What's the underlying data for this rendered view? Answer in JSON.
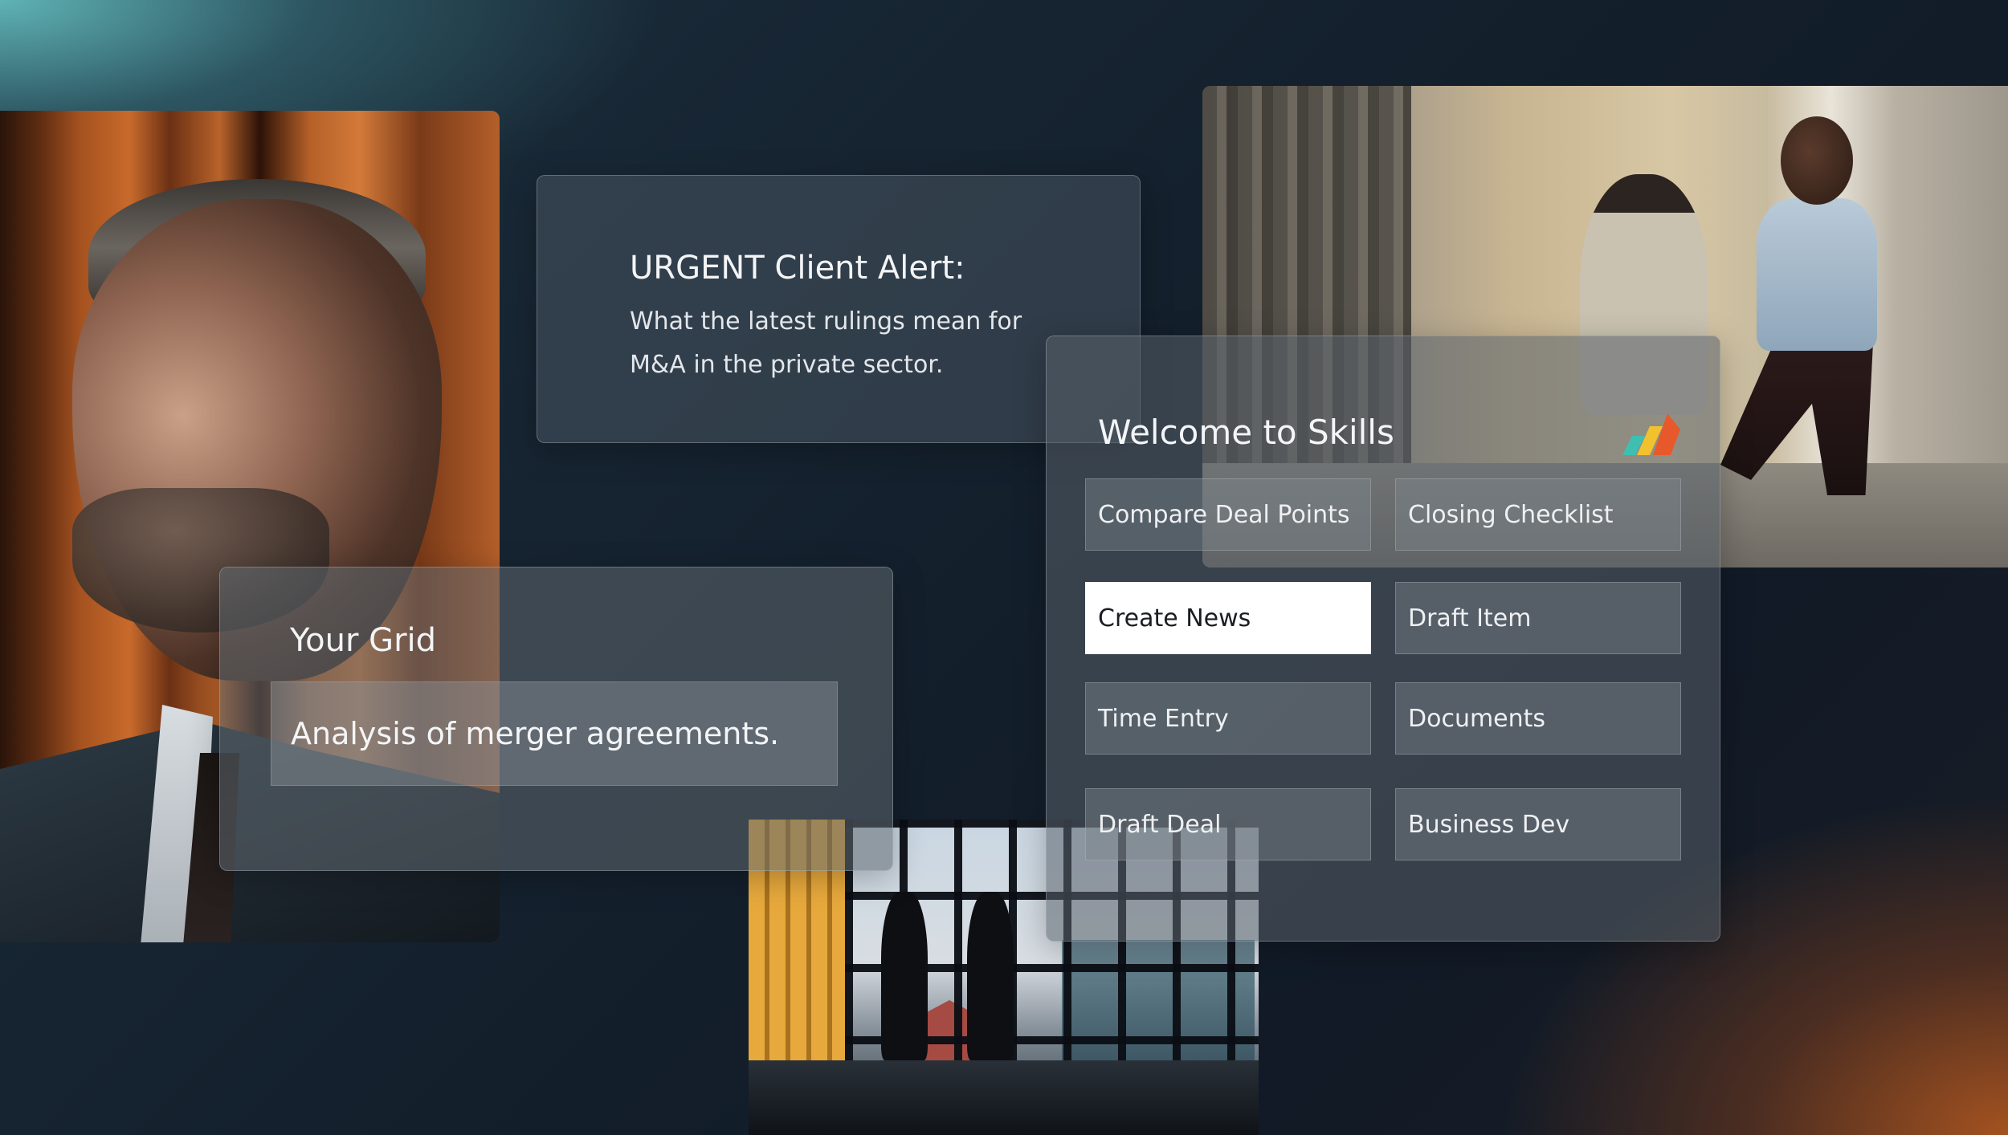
{
  "alert_card": {
    "title": "URGENT Client Alert:",
    "body": "What the latest rulings mean for M&A in the private sector."
  },
  "grid_card": {
    "title": "Your Grid",
    "input_value": "Analysis of merger agreements."
  },
  "skills_card": {
    "title": "Welcome to Skills",
    "logo_icon": "skills-logo-icon",
    "logo_colors": [
      "#3fbfb0",
      "#f2c12e",
      "#e7592b"
    ],
    "active_skill": "Create News",
    "skills": [
      "Compare Deal Points",
      "Closing Checklist",
      "Create News",
      "Draft Item",
      "Time Entry",
      "Documents",
      "Draft Deal",
      "Business Dev"
    ]
  },
  "photos": [
    "portrait-photo",
    "walking-colleagues-photo",
    "handshake-photo"
  ]
}
